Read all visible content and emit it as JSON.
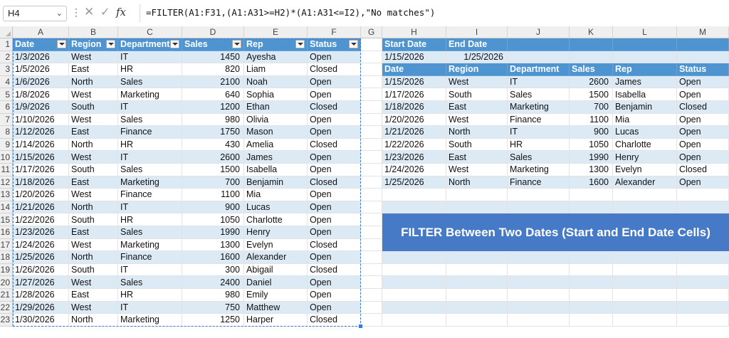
{
  "formula_bar": {
    "name_box": "H4",
    "name_box_icon": "chevron-down-icon",
    "more_icon": "vertical-ellipsis-icon",
    "cancel_icon": "cancel-x-icon",
    "enter_icon": "checkmark-icon",
    "fx_label": "fx",
    "formula": "=FILTER(A1:F31,(A1:A31>=H2)*(A1:A31<=I2),\"No matches\")"
  },
  "columns": [
    "A",
    "B",
    "C",
    "D",
    "E",
    "F",
    "G",
    "H",
    "I",
    "J",
    "K",
    "L",
    "M"
  ],
  "rows": [
    "1",
    "2",
    "3",
    "4",
    "5",
    "6",
    "7",
    "8",
    "9",
    "10",
    "11",
    "12",
    "13",
    "14",
    "15",
    "16",
    "17",
    "18",
    "19",
    "20",
    "21",
    "22",
    "23"
  ],
  "source_table": {
    "headers": [
      "Date",
      "Region",
      "Department",
      "Sales",
      "Rep",
      "Status"
    ],
    "rows": [
      [
        "1/3/2026",
        "West",
        "IT",
        "1450",
        "Ayesha",
        "Open"
      ],
      [
        "1/5/2026",
        "East",
        "HR",
        "820",
        "Liam",
        "Closed"
      ],
      [
        "1/6/2026",
        "North",
        "Sales",
        "2100",
        "Noah",
        "Open"
      ],
      [
        "1/8/2026",
        "West",
        "Marketing",
        "640",
        "Sophia",
        "Open"
      ],
      [
        "1/9/2026",
        "South",
        "IT",
        "1200",
        "Ethan",
        "Closed"
      ],
      [
        "1/10/2026",
        "West",
        "Sales",
        "980",
        "Olivia",
        "Open"
      ],
      [
        "1/12/2026",
        "East",
        "Finance",
        "1750",
        "Mason",
        "Open"
      ],
      [
        "1/14/2026",
        "North",
        "HR",
        "430",
        "Amelia",
        "Closed"
      ],
      [
        "1/15/2026",
        "West",
        "IT",
        "2600",
        "James",
        "Open"
      ],
      [
        "1/17/2026",
        "South",
        "Sales",
        "1500",
        "Isabella",
        "Open"
      ],
      [
        "1/18/2026",
        "East",
        "Marketing",
        "700",
        "Benjamin",
        "Closed"
      ],
      [
        "1/20/2026",
        "West",
        "Finance",
        "1100",
        "Mia",
        "Open"
      ],
      [
        "1/21/2026",
        "North",
        "IT",
        "900",
        "Lucas",
        "Open"
      ],
      [
        "1/22/2026",
        "South",
        "HR",
        "1050",
        "Charlotte",
        "Open"
      ],
      [
        "1/23/2026",
        "East",
        "Sales",
        "1990",
        "Henry",
        "Open"
      ],
      [
        "1/24/2026",
        "West",
        "Marketing",
        "1300",
        "Evelyn",
        "Closed"
      ],
      [
        "1/25/2026",
        "North",
        "Finance",
        "1600",
        "Alexander",
        "Open"
      ],
      [
        "1/26/2026",
        "South",
        "IT",
        "300",
        "Abigail",
        "Closed"
      ],
      [
        "1/27/2026",
        "West",
        "Sales",
        "2400",
        "Daniel",
        "Open"
      ],
      [
        "1/28/2026",
        "East",
        "HR",
        "980",
        "Emily",
        "Open"
      ],
      [
        "1/29/2026",
        "West",
        "IT",
        "750",
        "Matthew",
        "Open"
      ],
      [
        "1/30/2026",
        "North",
        "Marketing",
        "1250",
        "Harper",
        "Closed"
      ]
    ]
  },
  "criteria": {
    "start_label": "Start Date",
    "end_label": "End Date",
    "start_value": "1/15/2026",
    "end_value": "1/25/2026"
  },
  "result_table": {
    "headers": [
      "Date",
      "Region",
      "Department",
      "Sales",
      "Rep",
      "Status"
    ],
    "rows": [
      [
        "1/15/2026",
        "West",
        "IT",
        "2600",
        "James",
        "Open"
      ],
      [
        "1/17/2026",
        "South",
        "Sales",
        "1500",
        "Isabella",
        "Open"
      ],
      [
        "1/18/2026",
        "East",
        "Marketing",
        "700",
        "Benjamin",
        "Closed"
      ],
      [
        "1/20/2026",
        "West",
        "Finance",
        "1100",
        "Mia",
        "Open"
      ],
      [
        "1/21/2026",
        "North",
        "IT",
        "900",
        "Lucas",
        "Open"
      ],
      [
        "1/22/2026",
        "South",
        "HR",
        "1050",
        "Charlotte",
        "Open"
      ],
      [
        "1/23/2026",
        "East",
        "Sales",
        "1990",
        "Henry",
        "Open"
      ],
      [
        "1/24/2026",
        "West",
        "Marketing",
        "1300",
        "Evelyn",
        "Closed"
      ],
      [
        "1/25/2026",
        "North",
        "Finance",
        "1600",
        "Alexander",
        "Open"
      ]
    ]
  },
  "banner": {
    "text": "FILTER Between Two Dates (Start and End Date Cells)"
  },
  "colors": {
    "header_blue": "#4d94d1",
    "band_blue": "#dceaf6",
    "banner_blue": "#4679c6"
  }
}
